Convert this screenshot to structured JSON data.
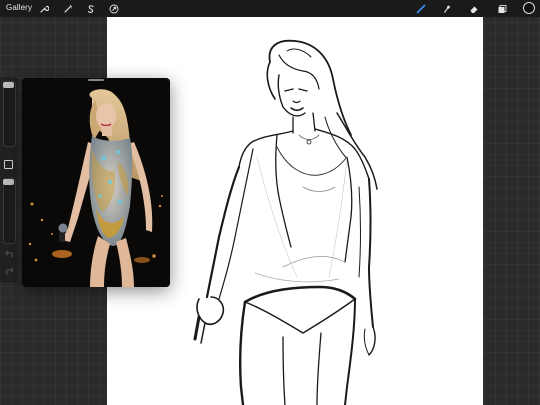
{
  "topbar": {
    "gallery_label": "Gallery",
    "left_tools": [
      {
        "name": "actions",
        "icon": "wrench-icon"
      },
      {
        "name": "adjustments",
        "icon": "magic-wand-icon"
      },
      {
        "name": "selection",
        "icon": "selection-s-icon"
      },
      {
        "name": "transform",
        "icon": "cursor-arrow-icon"
      }
    ],
    "right_tools": [
      {
        "name": "brush",
        "icon": "brush-icon",
        "active": true
      },
      {
        "name": "smudge",
        "icon": "smudge-icon",
        "active": false
      },
      {
        "name": "eraser",
        "icon": "eraser-icon",
        "active": false
      },
      {
        "name": "layers",
        "icon": "layers-icon",
        "active": false
      }
    ],
    "current_color": "#111111",
    "active_color": "#3e8cf5"
  },
  "sidebar": {
    "brush_size_level": 0.05,
    "opacity_level": 0.05
  },
  "reference": {
    "visible": true
  }
}
